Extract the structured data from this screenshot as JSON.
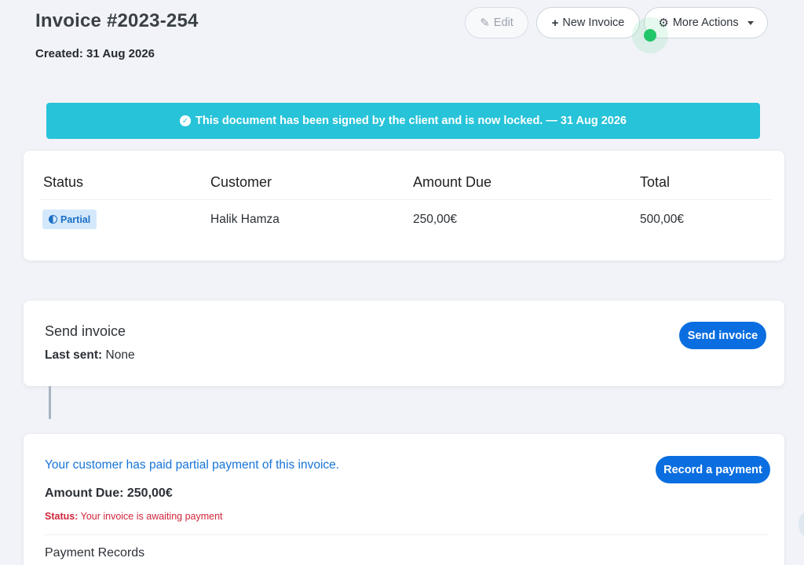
{
  "header": {
    "title": "Invoice #2023-254",
    "created_label": "Created:",
    "created_date": "31 Aug 2026"
  },
  "toolbar": {
    "edit_label": "Edit",
    "new_label": "New Invoice",
    "more_label": "More Actions"
  },
  "alert": {
    "text": "This document has been signed by the client and is now locked. — 31 Aug 2026",
    "color": "#27c3d9"
  },
  "summary": {
    "headers": [
      "Status",
      "Customer",
      "Amount Due",
      "Total"
    ],
    "status_badge": "Partial",
    "customer": "Halik Hamza",
    "amount_due": "250,00€",
    "total": "500,00€"
  },
  "send": {
    "title": "Send invoice",
    "last_sent_label": "Last sent:",
    "last_sent_value": "None",
    "button": "Send invoice"
  },
  "payment": {
    "message": "Your customer has paid partial payment of this invoice.",
    "amount_due": "Amount Due: 250,00€",
    "status_label": "Status:",
    "status_text": "Your invoice is awaiting payment",
    "records_title": "Payment Records",
    "button": "Record a payment"
  },
  "colors": {
    "primary": "#0a6ee0",
    "success": "#22c567",
    "danger": "#d0263b"
  }
}
